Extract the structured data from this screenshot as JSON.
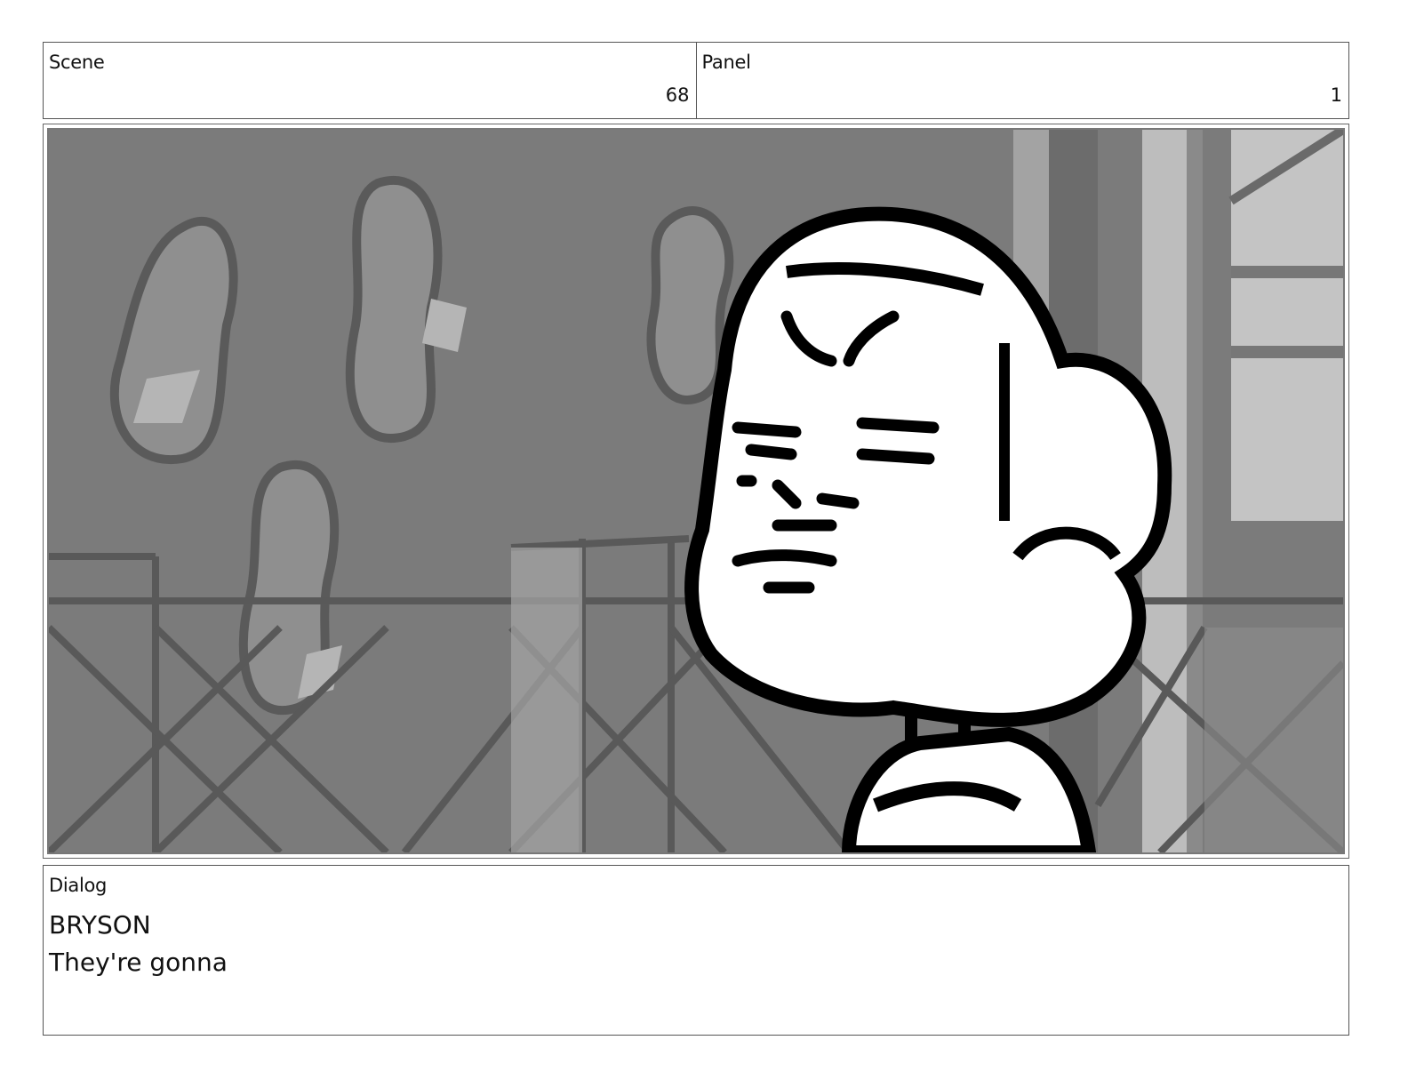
{
  "header": {
    "scene_label": "Scene",
    "scene_value": "68",
    "panel_label": "Panel",
    "panel_value": "1"
  },
  "frame": {
    "image_name": "storyboard-sketch"
  },
  "dialog": {
    "label": "Dialog",
    "speaker": "BRYSON",
    "line": "They're gonna"
  }
}
